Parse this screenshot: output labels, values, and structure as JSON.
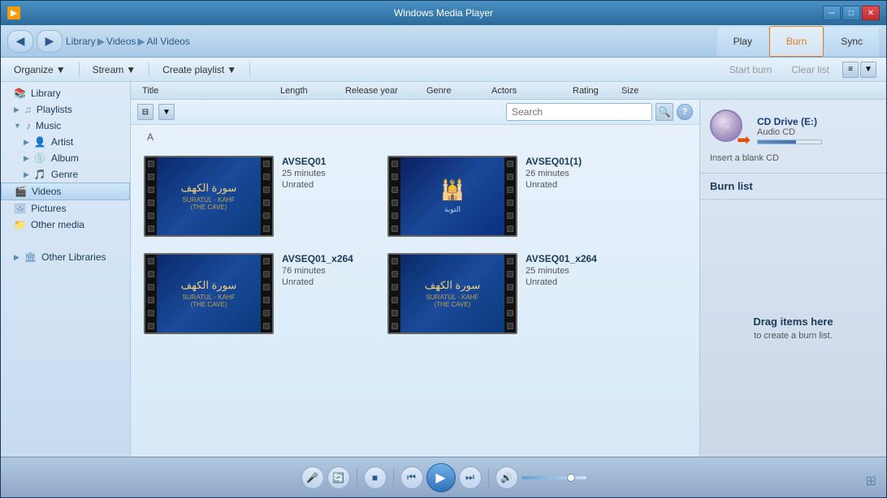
{
  "window": {
    "title": "Windows Media Player",
    "icon": "▶"
  },
  "title_bar": {
    "minimize": "─",
    "maximize": "□",
    "close": "✕"
  },
  "nav": {
    "back": "◀",
    "forward": "▶",
    "library": "Library",
    "videos": "Videos",
    "all_videos": "All Videos"
  },
  "tabs": {
    "play": "Play",
    "burn": "Burn",
    "sync": "Sync"
  },
  "toolbar": {
    "organize": "Organize",
    "stream": "Stream",
    "create_playlist": "Create playlist",
    "search_placeholder": "Search",
    "help": "?"
  },
  "columns": {
    "title": "Title",
    "length": "Length",
    "release_year": "Release year",
    "genre": "Genre",
    "actors": "Actors",
    "rating": "Rating",
    "size": "Size"
  },
  "sidebar": {
    "library": "Library",
    "playlists": "Playlists",
    "music": "Music",
    "artist": "Artist",
    "album": "Album",
    "genre": "Genre",
    "videos": "Videos",
    "pictures": "Pictures",
    "other_media": "Other media",
    "other_libraries": "Other Libraries"
  },
  "section_label": "A",
  "videos": [
    {
      "id": "v1",
      "title": "AVSEQ01",
      "duration": "25 minutes",
      "rating": "Unrated",
      "type": "cave"
    },
    {
      "id": "v2",
      "title": "AVSEQ01(1)",
      "duration": "26 minutes",
      "rating": "Unrated",
      "type": "mosque"
    },
    {
      "id": "v3",
      "title": "AVSEQ01_x264",
      "duration": "76 minutes",
      "rating": "Unrated",
      "type": "cave"
    },
    {
      "id": "v4",
      "title": "AVSEQ01_x264",
      "duration": "25 minutes",
      "rating": "Unrated",
      "type": "cave"
    }
  ],
  "right_panel": {
    "drive_name": "CD Drive (E:)",
    "drive_type": "Audio CD",
    "insert_msg": "Insert a blank CD",
    "burn_list_title": "Burn list",
    "drag_text": "Drag items here",
    "drag_sub": "to create a burn list."
  },
  "player": {
    "start_burn": "Start burn",
    "clear_list": "Clear list"
  }
}
